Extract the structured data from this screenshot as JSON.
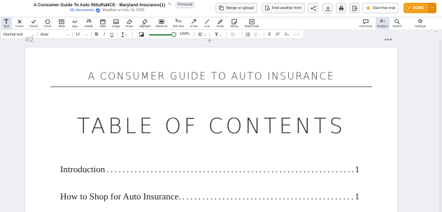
{
  "header": {
    "title": "A Consumer Guide To Auto INSuRaNCE - Maryland Insurance(1)",
    "badge": "Personal",
    "location_link": "My documents",
    "modified": "Modified on Feb 18, 2025",
    "buttons": {
      "merge": "Merge or upload",
      "find": "Find another form",
      "trial": "Start free trial",
      "done": "DONE"
    }
  },
  "tools": [
    {
      "label": "Text",
      "icon": "text-icon"
    },
    {
      "label": "Cross",
      "icon": "cross-icon"
    },
    {
      "label": "Check",
      "icon": "check-icon"
    },
    {
      "label": "Circle",
      "icon": "circle-icon"
    },
    {
      "label": "Table",
      "icon": "table-icon"
    },
    {
      "label": "Sign",
      "icon": "sign-icon"
    },
    {
      "label": "Initials",
      "icon": "initials-icon"
    },
    {
      "label": "Date",
      "icon": "date-icon"
    },
    {
      "label": "Image",
      "icon": "image-icon"
    },
    {
      "label": "Erase",
      "icon": "erase-icon"
    },
    {
      "label": "Highlight",
      "icon": "highlight-icon"
    },
    {
      "label": "Blackout",
      "icon": "blackout-icon"
    },
    {
      "label": "Text Box",
      "icon": "textbox-icon"
    },
    {
      "label": "Arrow",
      "icon": "arrow-icon"
    },
    {
      "label": "Line",
      "icon": "line-icon"
    },
    {
      "label": "Draw",
      "icon": "draw-icon"
    },
    {
      "label": "Sticky",
      "icon": "sticky-icon"
    },
    {
      "label": "Watermark",
      "icon": "watermark-icon"
    }
  ],
  "right_tools": [
    {
      "label": "Comment",
      "icon": "comment-icon"
    },
    {
      "label": "Replace",
      "icon": "replace-icon"
    },
    {
      "label": "Search",
      "icon": "search-icon"
    },
    {
      "label": "Settings",
      "icon": "gear-icon"
    }
  ],
  "format": {
    "style": "Normal text",
    "font": "Arial",
    "size": "12",
    "zoom": "100%",
    "zoom_fraction": 1.0
  },
  "canvas": {
    "page_label": "#2",
    "doc_heading": "A CONSUMER GUIDE TO AUTO INSURANCE",
    "toc_title": "TABLE OF CONTENTS",
    "toc": [
      {
        "label": "Introduction",
        "page": "1"
      },
      {
        "label": "How to Shop for Auto Insurance.",
        "page": "1"
      }
    ]
  },
  "colors": {
    "accent": "#2f67d8",
    "done": "#f3a01c",
    "slider": "#3c8f4a"
  }
}
